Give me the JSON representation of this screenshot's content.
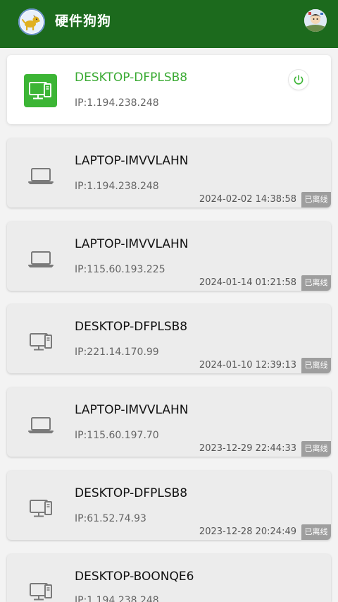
{
  "app": {
    "title": "硬件狗狗",
    "logo_icon": "dog-logo-icon",
    "avatar_icon": "user-avatar",
    "header_color": "#1c6a1d"
  },
  "current_device": {
    "name": "DESKTOP-DFPLSB8",
    "ip": "IP:1.194.238.248",
    "icon": "desktop-computer-icon",
    "accent": "#3cb535",
    "action_icon": "power-icon"
  },
  "devices": [
    {
      "name": "LAPTOP-IMVVLAHN",
      "ip": "IP:1.194.238.248",
      "time": "2024-02-02 14:38:58",
      "status": "已离线",
      "icon": "laptop-icon"
    },
    {
      "name": "LAPTOP-IMVVLAHN",
      "ip": "IP:115.60.193.225",
      "time": "2024-01-14 01:21:58",
      "status": "已离线",
      "icon": "laptop-icon"
    },
    {
      "name": "DESKTOP-DFPLSB8",
      "ip": "IP:221.14.170.99",
      "time": "2024-01-10 12:39:13",
      "status": "已离线",
      "icon": "desktop-computer-icon"
    },
    {
      "name": "LAPTOP-IMVVLAHN",
      "ip": "IP:115.60.197.70",
      "time": "2023-12-29 22:44:33",
      "status": "已离线",
      "icon": "laptop-icon"
    },
    {
      "name": "DESKTOP-DFPLSB8",
      "ip": "IP:61.52.74.93",
      "time": "2023-12-28 20:24:49",
      "status": "已离线",
      "icon": "desktop-computer-icon"
    },
    {
      "name": "DESKTOP-BOONQE6",
      "ip": "IP:1.194.238.248",
      "time": "",
      "status": "",
      "icon": "desktop-computer-icon"
    }
  ]
}
